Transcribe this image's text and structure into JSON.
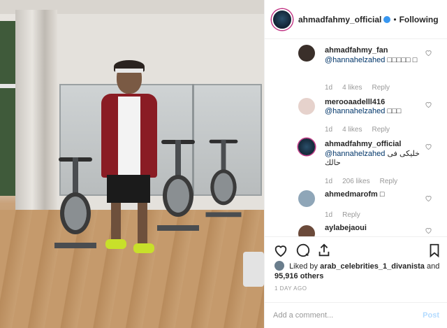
{
  "post": {
    "header": {
      "username": "ahmadfahmy_official",
      "separator": "•",
      "follow_status": "Following"
    },
    "comments": [
      {
        "username": "ahmadfahmy_fan",
        "mention": "@hannahelzahed",
        "text": "□□□□□ □",
        "age": "1d",
        "likes": "4 likes",
        "reply": "Reply"
      },
      {
        "username": "merooaadelll416",
        "mention": "@hannahelzahed",
        "text": "□□□",
        "age": "1d",
        "likes": "4 likes",
        "reply": "Reply"
      },
      {
        "username": "ahmadfahmy_official",
        "mention": "@hannahelzahed",
        "text": "خليكى فى حالك",
        "age": "1d",
        "likes": "206 likes",
        "reply": "Reply"
      },
      {
        "username": "ahmedmarofm",
        "mention": "",
        "text": "□",
        "age": "1d",
        "likes": "",
        "reply": "Reply"
      },
      {
        "username": "aylabejaoui",
        "mention": "",
        "text": "",
        "age": "",
        "likes": "",
        "reply": ""
      }
    ],
    "likes": {
      "prefix": "Liked by",
      "user": "arab_celebrities_1_divanista",
      "conj": "and",
      "others": "95,916 others"
    },
    "timestamp": "1 DAY AGO",
    "add_comment": {
      "placeholder": "Add a comment...",
      "post_label": "Post"
    },
    "colors": {
      "link": "#003569",
      "muted": "#999999",
      "verified": "#3897f0",
      "post_disabled": "#b3dbff"
    }
  }
}
